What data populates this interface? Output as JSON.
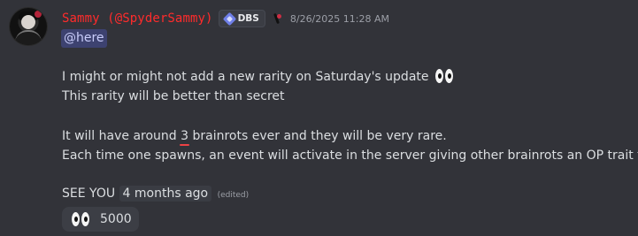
{
  "header": {
    "username": "Sammy (@SpyderSammy)",
    "tag": "DBS",
    "timestamp": "8/26/2025 11:28 AM"
  },
  "message": {
    "mention": "@here",
    "line1": "I might or might not add a new rarity on Saturday's update",
    "line2": "This rarity will be better than secret",
    "line3_before": "It will have around ",
    "line3_number": "3",
    "line3_after": " brainrots ever and they will be very rare.",
    "line4": "Each time one spawns, an event will activate in the server giving other brainrots an OP trait too",
    "line5_prefix": "SEE YOU",
    "line5_time": "4 months ago",
    "edited": "(edited)"
  },
  "reaction": {
    "emoji_icon": "eyes-emoji-icon",
    "count": "5000"
  },
  "colors": {
    "background": "#323339",
    "username": "#ff2b2b",
    "mention_bg": "#3d4270",
    "mention_text": "#c9cdfb",
    "underline": "#ed4245"
  }
}
